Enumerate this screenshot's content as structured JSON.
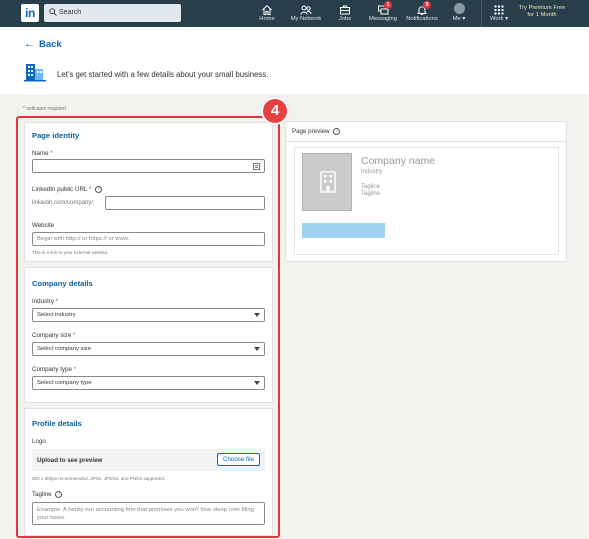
{
  "nav": {
    "logo": "in",
    "search_placeholder": "Search",
    "items": [
      {
        "label": "Home"
      },
      {
        "label": "My Network"
      },
      {
        "label": "Jobs"
      },
      {
        "label": "Messaging",
        "badge": "1"
      },
      {
        "label": "Notifications",
        "badge": "9"
      },
      {
        "label": "Me"
      },
      {
        "label": "Work"
      }
    ],
    "premium_line1": "Try Premium Free",
    "premium_line2": "for 1 Month"
  },
  "header": {
    "back_label": "Back",
    "intro": "Let’s get started with a few details about your small business."
  },
  "required_note": "* indicates required",
  "step_number": "4",
  "page_identity": {
    "title": "Page identity",
    "name_label": "Name",
    "url_label": "LinkedIn public URL",
    "url_prefix": "linkedin.com/company/",
    "website_label": "Website",
    "website_placeholder": "Begin with http:// or https:// or www.",
    "website_hint": "This is a link to your external website."
  },
  "company_details": {
    "title": "Company details",
    "industry_label": "Industry",
    "industry_value": "Select industry",
    "size_label": "Company size",
    "size_value": "Select company size",
    "type_label": "Company type",
    "type_value": "Select company type"
  },
  "profile_details": {
    "title": "Profile details",
    "logo_label": "Logo",
    "upload_text": "Upload to see preview",
    "choose_file": "Choose file",
    "upload_hint": "300 x 300px recommended. JPGs, JPEGs, and PNGs supported.",
    "tagline_label": "Tagline",
    "tagline_placeholder": "Example: A family-run accounting firm that promises you won't lose sleep over filing your taxes."
  },
  "preview": {
    "title": "Page preview",
    "company_name": "Company name",
    "industry": "Industry",
    "tagline1": "Tagline",
    "tagline2": "Tagline"
  },
  "colors": {
    "nav_bg": "#283e4a",
    "link_blue": "#0a66c2",
    "highlight_red": "#e0363e",
    "preview_button": "#9fd4f0"
  }
}
